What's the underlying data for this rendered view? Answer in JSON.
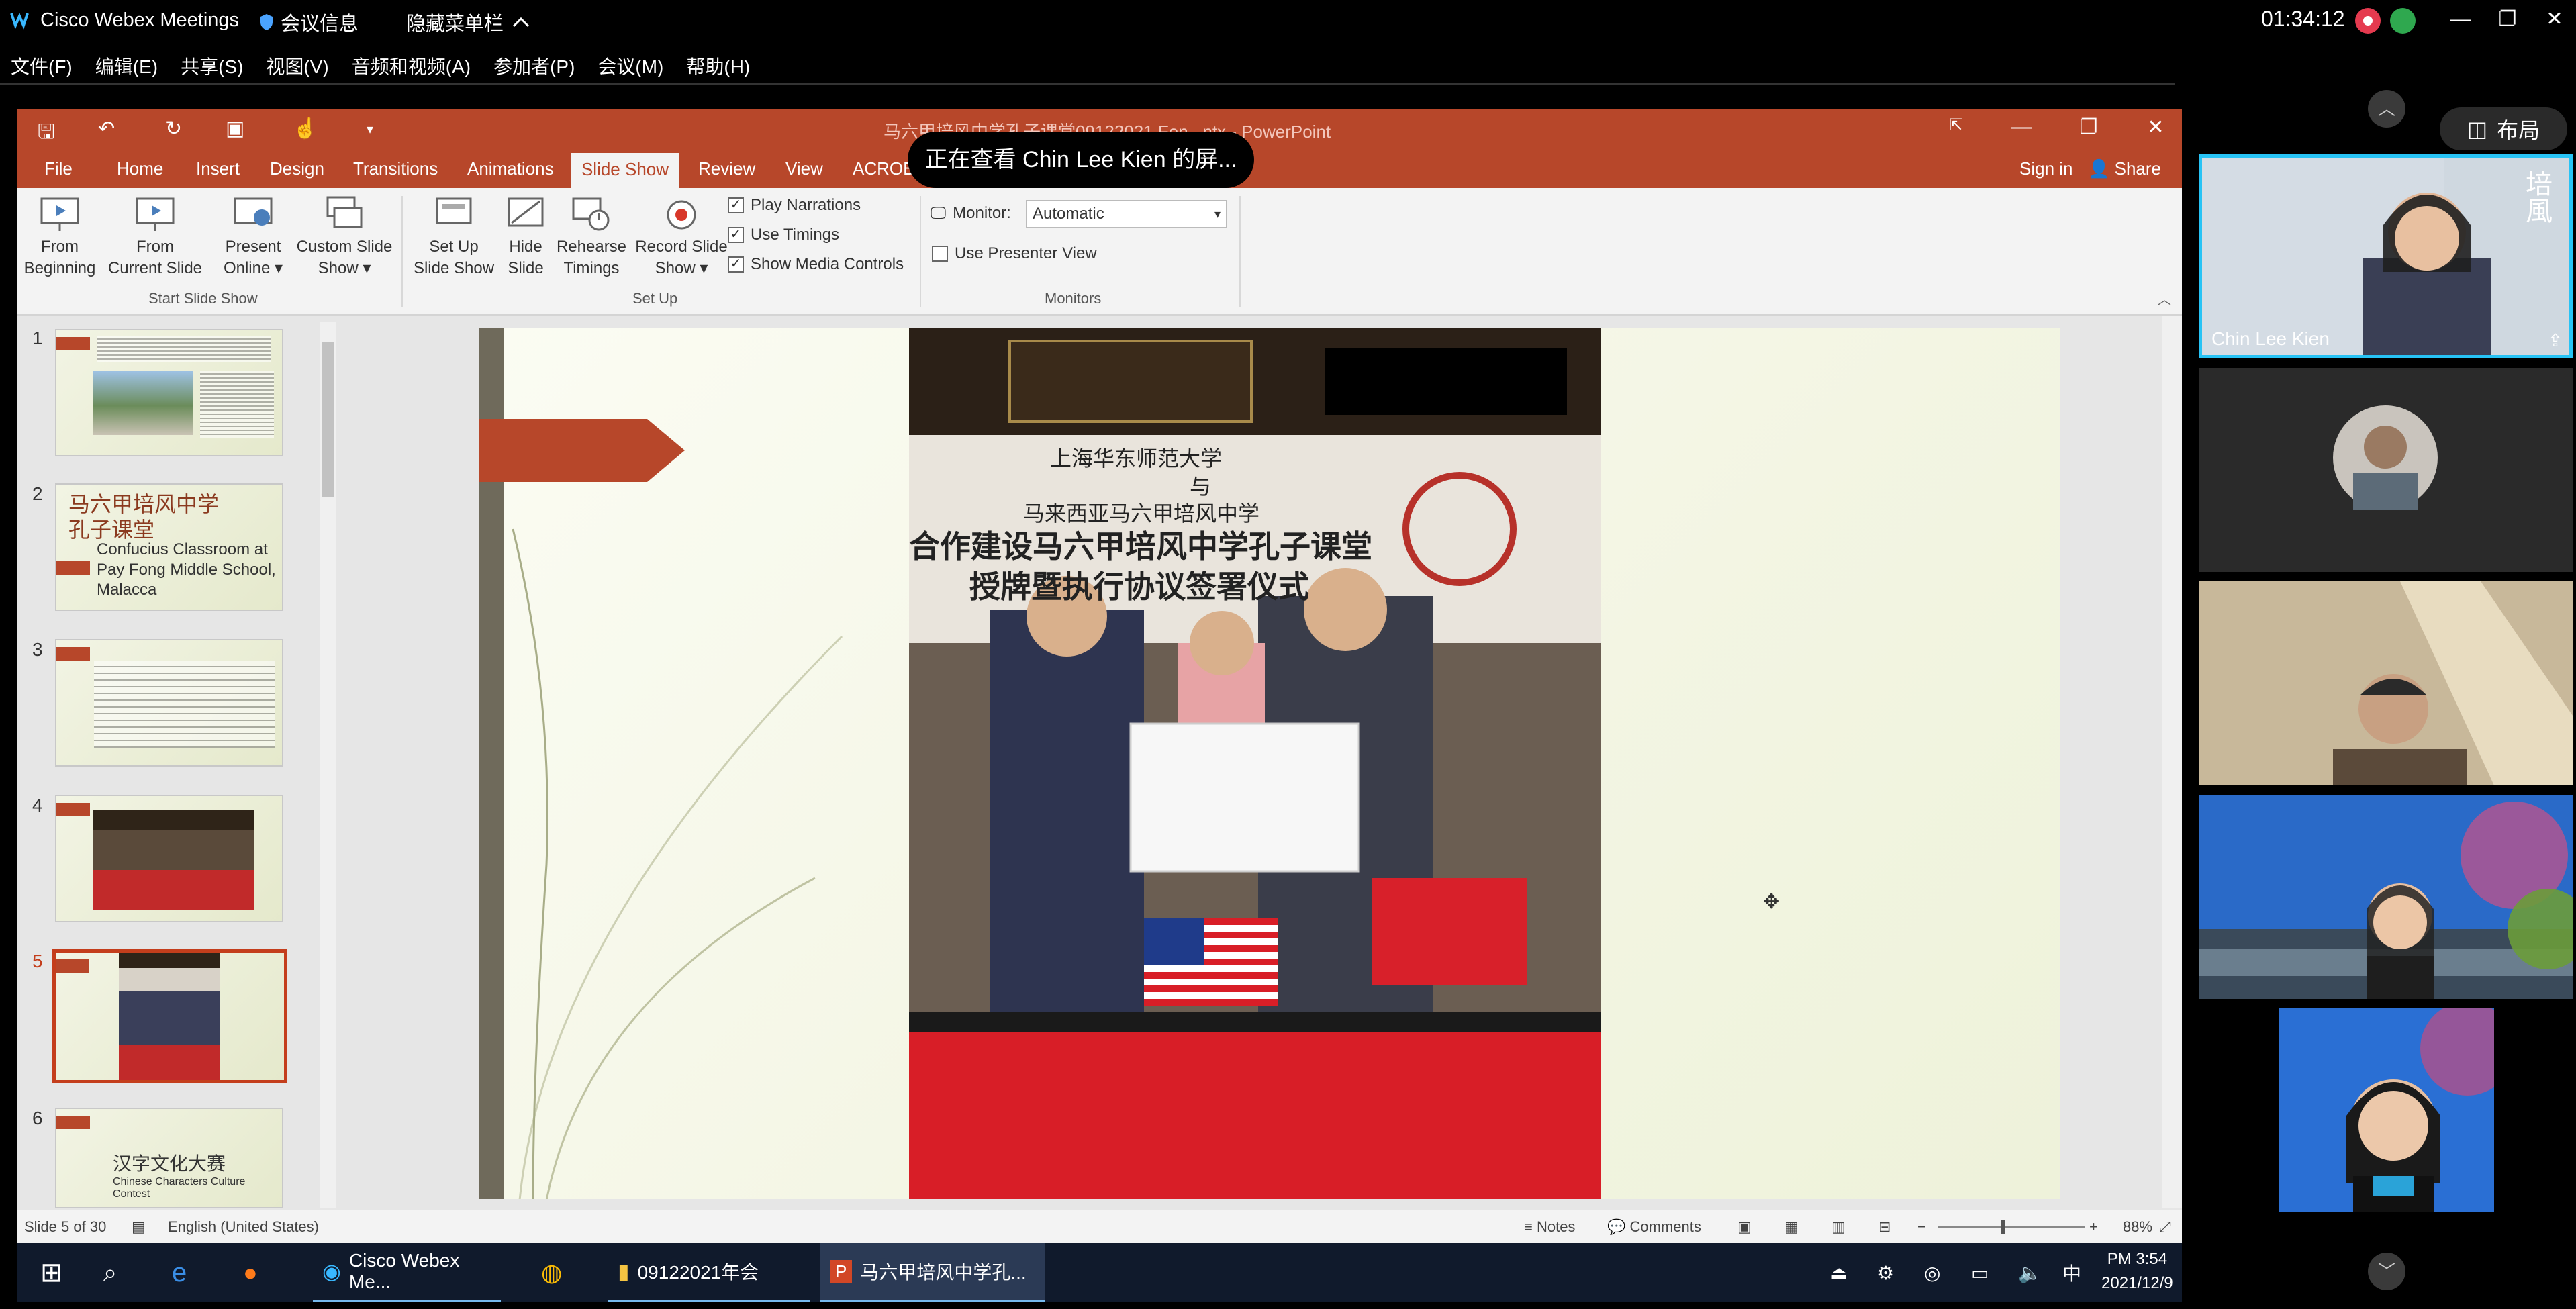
{
  "webex": {
    "app_title": "Cisco Webex Meetings",
    "meeting_info": "会议信息",
    "hide_menu": "隐藏菜单栏",
    "clock": "01:34:12",
    "menu": [
      "文件(F)",
      "编辑(E)",
      "共享(S)",
      "视图(V)",
      "音频和视频(A)",
      "参加者(P)",
      "会议(M)",
      "帮助(H)"
    ],
    "layout_label": "布局",
    "sharing_banner": "正在查看 Chin Lee Kien 的屏...",
    "colors": {
      "active_border": "#27c3f5",
      "record": "#e53a4f"
    }
  },
  "powerpoint": {
    "doc_title": "马六甲培风中学孔子课堂09122021 Fon...ntx - PowerPoint",
    "tabs": [
      "File",
      "Home",
      "Insert",
      "Design",
      "Transitions",
      "Animations",
      "Slide Show",
      "Review",
      "View",
      "ACROB"
    ],
    "active_tab": "Slide Show",
    "sign_in": "Sign in",
    "share": "Share",
    "ribbon": {
      "from_beginning": [
        "From",
        "Beginning"
      ],
      "from_current": [
        "From",
        "Current Slide"
      ],
      "present_online": [
        "Present",
        "Online ▾"
      ],
      "custom_show": [
        "Custom Slide",
        "Show ▾"
      ],
      "group_start": "Start Slide Show",
      "setup_show": [
        "Set Up",
        "Slide Show"
      ],
      "hide_slide": [
        "Hide",
        "Slide"
      ],
      "rehearse": [
        "Rehearse",
        "Timings"
      ],
      "record": [
        "Record Slide",
        "Show ▾"
      ],
      "play_narrations": "Play Narrations",
      "use_timings": "Use Timings",
      "show_media": "Show Media Controls",
      "group_setup": "Set Up",
      "monitor_label": "Monitor:",
      "monitor_value": "Automatic",
      "presenter_view": "Use Presenter View",
      "group_monitors": "Monitors"
    },
    "thumbnails": [
      {
        "num": "1"
      },
      {
        "num": "2",
        "title_cn": "马六甲培风中学",
        "title_cn2": "孔子课堂",
        "text": "Confucius Classroom at Pay Fong Middle School, Malacca"
      },
      {
        "num": "3"
      },
      {
        "num": "4"
      },
      {
        "num": "5"
      },
      {
        "num": "6",
        "title_cn": "汉字文化大赛",
        "text": "Chinese Characters Culture Contest"
      }
    ],
    "photo": {
      "line1": "上海华东师范大学",
      "line2": "与",
      "line3": "马来西亚马六甲培风中学",
      "line4": "合作建设马六甲培风中学孔子课堂",
      "line5": "授牌暨执行协议签署仪式"
    },
    "status": {
      "slide": "Slide 5 of 30",
      "language": "English (United States)",
      "notes": "Notes",
      "comments": "Comments",
      "zoom": "88%"
    }
  },
  "taskbar": {
    "items": [
      "Cisco Webex Me...",
      "09122021年会",
      "马六甲培风中学孔..."
    ],
    "time": "PM 3:54",
    "date": "2021/12/9",
    "ime": "中"
  },
  "participants": [
    {
      "name": "Chin Lee Kien",
      "active": true
    },
    {
      "name": ""
    },
    {
      "name": ""
    },
    {
      "name": ""
    },
    {
      "name": ""
    }
  ]
}
